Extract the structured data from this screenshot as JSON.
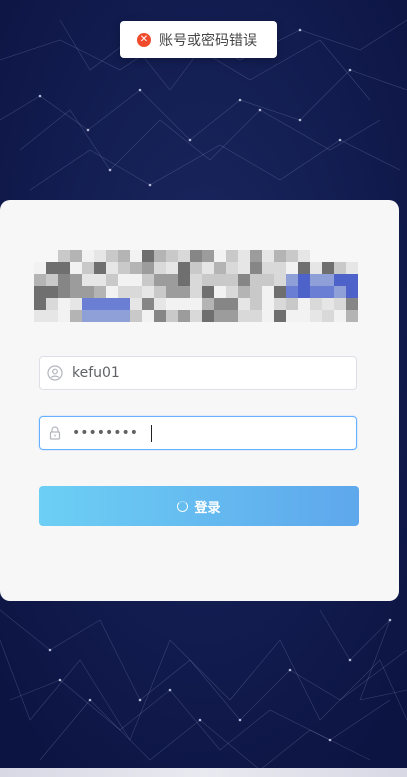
{
  "toast": {
    "icon": "error-icon",
    "message": "账号或密码错误",
    "accent": "#f04b2c"
  },
  "login": {
    "username_value": "kefu01",
    "password_value": "********",
    "username_icon": "user-icon",
    "password_icon": "lock-icon",
    "submit_label": "登录",
    "submit_loading": true
  },
  "colors": {
    "background": "#0f1848",
    "card": "#f7f7f7",
    "button_from": "#6ccff4",
    "button_to": "#5ea7ec",
    "focus_border": "#66b1ff"
  }
}
